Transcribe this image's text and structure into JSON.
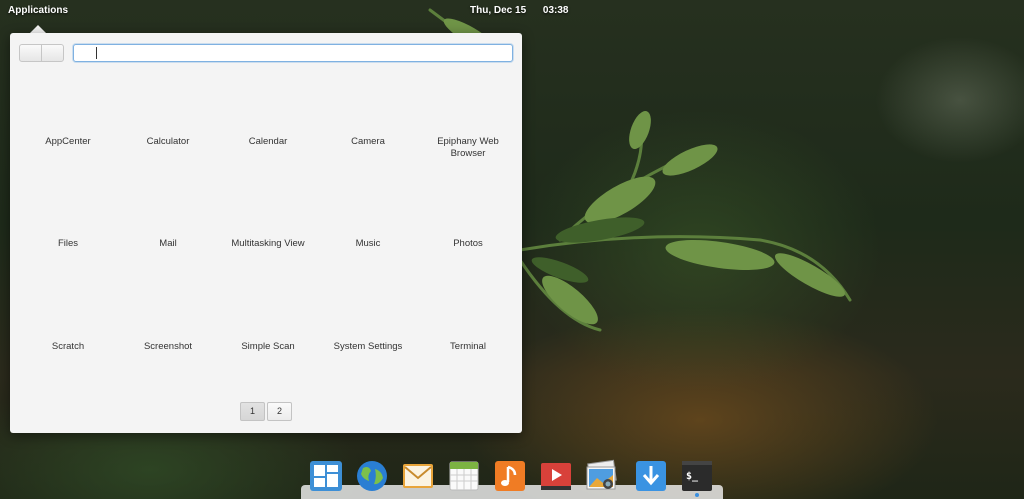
{
  "panel": {
    "applications": "Applications",
    "date": "Thu, Dec 15",
    "time": "03:38"
  },
  "search": {
    "value": ""
  },
  "apps": [
    {
      "label": "AppCenter"
    },
    {
      "label": "Calculator"
    },
    {
      "label": "Calendar"
    },
    {
      "label": "Camera"
    },
    {
      "label": "Epiphany Web Browser"
    },
    {
      "label": "Files"
    },
    {
      "label": "Mail"
    },
    {
      "label": "Multitasking View"
    },
    {
      "label": "Music"
    },
    {
      "label": "Photos"
    },
    {
      "label": "Scratch"
    },
    {
      "label": "Screenshot"
    },
    {
      "label": "Simple Scan"
    },
    {
      "label": "System Settings"
    },
    {
      "label": "Terminal"
    }
  ],
  "pages": [
    "1",
    "2"
  ],
  "current_page": 1,
  "dock": [
    {
      "icon": "multitasking-view-icon"
    },
    {
      "icon": "web-browser-icon"
    },
    {
      "icon": "mail-icon"
    },
    {
      "icon": "calendar-icon"
    },
    {
      "icon": "music-icon"
    },
    {
      "icon": "videos-icon"
    },
    {
      "icon": "photos-icon"
    },
    {
      "icon": "appcenter-download-icon"
    },
    {
      "icon": "terminal-icon",
      "text": "$_",
      "running": true
    }
  ]
}
